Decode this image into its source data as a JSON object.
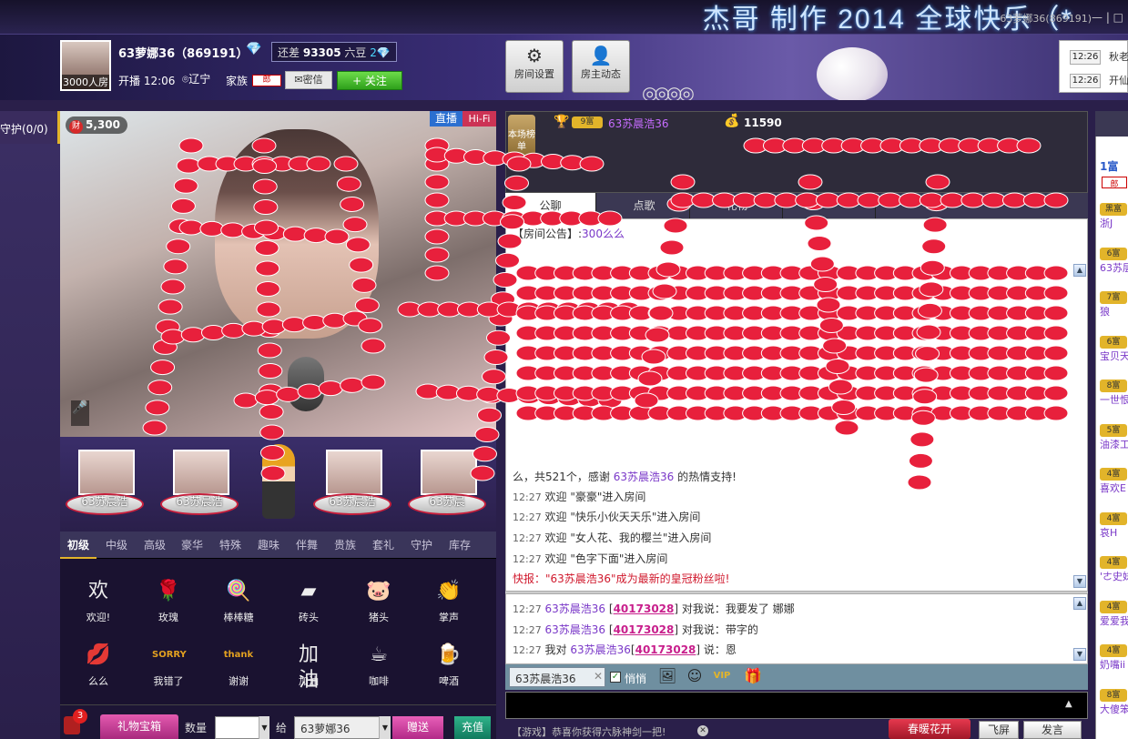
{
  "banner": {
    "text": "杰哥 制作 2014 全球快乐（*",
    "user": "63萝娜36(869191)"
  },
  "host": {
    "avatar_caption": "3000人房",
    "name": "63萝娜36（869191）",
    "gap_label": "还差",
    "gap_value": "93305",
    "gap_unit": "六豆",
    "gap_level": "2",
    "live_time": "开播 12:06",
    "location": "辽宁",
    "family_label": "家族",
    "family_tag": "郎",
    "msg_btn": "密信",
    "follow_btn": "+ 关注"
  },
  "header_buttons": {
    "room_settings": "房间设置",
    "host_feed": "房主动态"
  },
  "notices": [
    {
      "time": "12:26",
      "msg": "秋老"
    },
    {
      "time": "12:26",
      "msg": "开仙"
    }
  ],
  "guard_tab": "守护(0/0)",
  "video": {
    "wealth_icon": "财",
    "wealth": "5,300",
    "live_tag": "直播",
    "hifi_tag": "Hi-Fi"
  },
  "seats": [
    {
      "name": "63苏晨浩"
    },
    {
      "name": "63苏晨浩"
    },
    {
      "name": "63苏晨浩"
    },
    {
      "name": "63苏晨"
    }
  ],
  "gift_tabs": [
    "初级",
    "中级",
    "高级",
    "豪华",
    "特殊",
    "趣味",
    "伴舞",
    "贵族",
    "套礼",
    "守护",
    "库存"
  ],
  "gifts": [
    {
      "name": "欢迎!",
      "icon": "welcome-icon",
      "glyph": "欢"
    },
    {
      "name": "玫瑰",
      "icon": "rose-icon",
      "glyph": "🌹"
    },
    {
      "name": "棒棒糖",
      "icon": "lollipop-icon",
      "glyph": "🍭"
    },
    {
      "name": "砖头",
      "icon": "brick-icon",
      "glyph": "▰"
    },
    {
      "name": "猪头",
      "icon": "pig-icon",
      "glyph": "🐷"
    },
    {
      "name": "掌声",
      "icon": "clap-icon",
      "glyph": "👏"
    },
    {
      "name": "么么",
      "icon": "kiss-icon",
      "glyph": "💋"
    },
    {
      "name": "我错了",
      "icon": "sorry-icon",
      "glyph": "SORRY"
    },
    {
      "name": "谢谢",
      "icon": "thanks-icon",
      "glyph": "thank"
    },
    {
      "name": "加油",
      "icon": "cheer-icon",
      "glyph": "加油"
    },
    {
      "name": "咖啡",
      "icon": "coffee-icon",
      "glyph": "☕"
    },
    {
      "name": "啤酒",
      "icon": "beer-icon",
      "glyph": "🍺"
    }
  ],
  "bottom_bar": {
    "badge": "3",
    "box_btn": "礼物宝箱",
    "qty_label": "数量",
    "to_label": "给",
    "to_value": "63萝娜36",
    "send_btn": "赠送",
    "charge_btn": "充值"
  },
  "rank": {
    "tag": "本场榜单",
    "level": "9富",
    "user": "63苏晨浩36",
    "score": "11590"
  },
  "chat_tabs": [
    "公聊",
    "点歌",
    "礼物",
    ""
  ],
  "public_chat": {
    "announce_prefix": "【房间公告】:",
    "announce_text": "300么么",
    "thanks_line": "么，共521个，感谢",
    "thanks_user": "63苏晨浩36",
    "thanks_suffix": "的热情支持!",
    "welcomes": [
      {
        "time": "12:27",
        "text": "欢迎 \"豪豪\"进入房间"
      },
      {
        "time": "12:27",
        "text": "欢迎 \"快乐小伙天天乐\"进入房间"
      },
      {
        "time": "12:27",
        "text": "欢迎 \"女人花、我的樱兰\"进入房间"
      },
      {
        "time": "12:27",
        "text": "欢迎 \"色字下面\"进入房间"
      }
    ],
    "flash": "快报：\"63苏晨浩36\"成为最新的皇冠粉丝啦!"
  },
  "private_chat": [
    {
      "time": "12:27",
      "user": "63苏晨浩36",
      "id": "40173028",
      "text": "对我说：我要发了 娜娜"
    },
    {
      "time": "12:27",
      "user": "63苏晨浩36",
      "id": "40173028",
      "text": "对我说：带字的"
    },
    {
      "time": "12:27",
      "prefix": "我对",
      "user": "63苏晨浩36",
      "id": "40173028",
      "text": "说：恩"
    }
  ],
  "toolbar": {
    "target": "63苏晨浩36",
    "whisper": "悄悄"
  },
  "bottom_right": {
    "game_msg": "【游戏】恭喜你获得六脉神剑一把!",
    "flower_btn": "春暖花开",
    "fly_btn": "飞屏",
    "say_btn": "发言"
  },
  "userlist": {
    "top_user_level": "1富",
    "top_user_tag": "郎",
    "items": [
      {
        "lvl": "黑富",
        "name": "浙J"
      },
      {
        "lvl": "6富",
        "name": "63苏层"
      },
      {
        "lvl": "7富",
        "name": "狼"
      },
      {
        "lvl": "6富",
        "name": "宝贝天"
      },
      {
        "lvl": "8富",
        "name": "一世恨"
      },
      {
        "lvl": "5富",
        "name": "油漆工"
      },
      {
        "lvl": "4富",
        "name": "喜欢E"
      },
      {
        "lvl": "4富",
        "name": "哀H"
      },
      {
        "lvl": "4富",
        "name": "'ㄜ史妹"
      },
      {
        "lvl": "4富",
        "name": "爱爱我"
      },
      {
        "lvl": "4富",
        "name": "奶嘴ii"
      },
      {
        "lvl": "8富",
        "name": "大傻笨"
      }
    ]
  },
  "overlay": {
    "hearts_color": "#e8203c",
    "characters": "我爱你么么"
  }
}
